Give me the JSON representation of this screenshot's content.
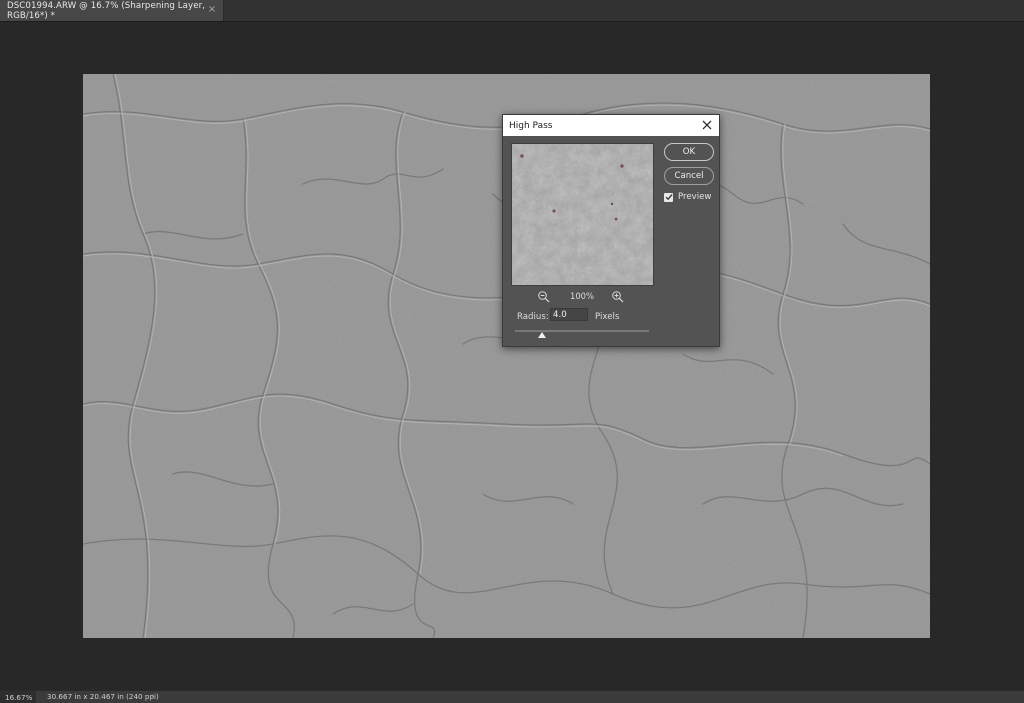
{
  "document_tab": {
    "title": "DSC01994.ARW @ 16.7% (Sharpening Layer, RGB/16*) *",
    "close_glyph": "×"
  },
  "dialog": {
    "title": "High Pass",
    "ok_label": "OK",
    "cancel_label": "Cancel",
    "preview_label": "Preview",
    "preview_checked": true,
    "zoom_level": "100%",
    "radius_label": "Radius:",
    "radius_value": "4.0",
    "radius_units": "Pixels",
    "radius_slider_fraction": 0.2
  },
  "statusbar": {
    "zoom": "16.67%",
    "doc_info": "30.667 in x 20.467 in (240 ppi)",
    "arrow": "›"
  },
  "colors": {
    "workspace": "#282828",
    "canvas_gray": "#8f8f8f",
    "dialog_bg": "#535353",
    "title_bar": "#ffffff"
  },
  "icons": [
    "close-icon",
    "zoom-out-icon",
    "zoom-in-icon",
    "checkmark-icon",
    "slider-thumb-icon"
  ]
}
